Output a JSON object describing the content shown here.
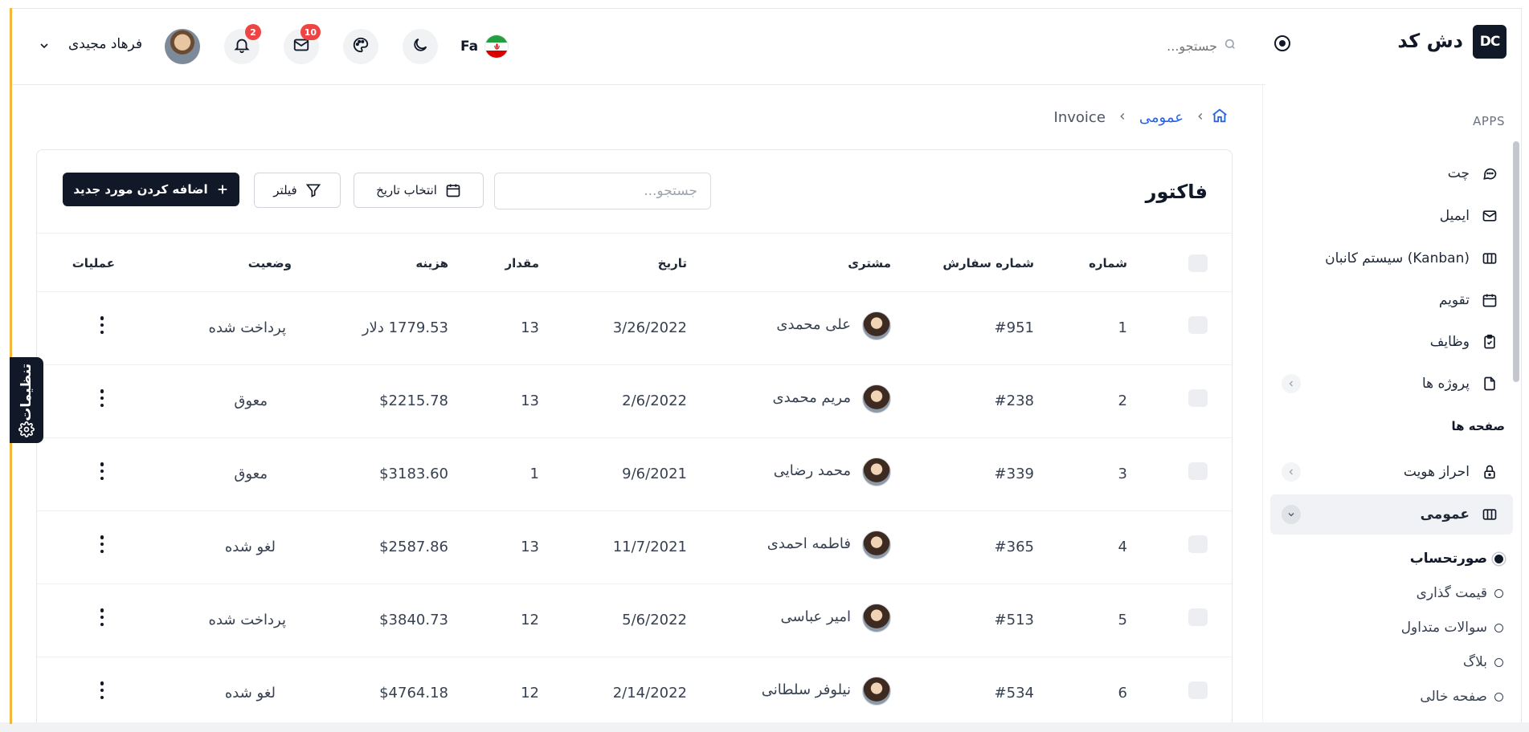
{
  "app": {
    "brand": "دش کد",
    "logo_text": "DC"
  },
  "sidebar": {
    "section_apps": "APPS",
    "apps": [
      {
        "label": "چت",
        "icon": "chat-icon"
      },
      {
        "label": "ایمیل",
        "icon": "mail-icon"
      },
      {
        "label": "سیستم کانبان (Kanban)",
        "icon": "kanban-icon"
      },
      {
        "label": "تقویم",
        "icon": "calendar-icon"
      },
      {
        "label": "وظایف",
        "icon": "clipboard-icon"
      },
      {
        "label": "پروژه ها",
        "icon": "file-icon"
      }
    ],
    "section_pages": "صفحه ها",
    "pages": [
      {
        "label": "احراز هویت",
        "icon": "lock-icon"
      },
      {
        "label": "عمومی",
        "icon": "columns-icon"
      }
    ],
    "sub_items": [
      {
        "label": "صورتحساب",
        "active": true
      },
      {
        "label": "قیمت گذاری",
        "active": false
      },
      {
        "label": "سوالات متداول",
        "active": false
      },
      {
        "label": "بلاگ",
        "active": false
      },
      {
        "label": "صفحه خالی",
        "active": false
      }
    ]
  },
  "header": {
    "search_placeholder": "جستجو...",
    "language": "Fa",
    "mail_count": "10",
    "notification_count": "2",
    "user_name": "فرهاد مجیدی"
  },
  "breadcrumb": {
    "parent": "عمومی",
    "current": "Invoice"
  },
  "card": {
    "title": "فاکتور",
    "search_placeholder": "جستجو...",
    "date_button": "انتخاب تاریخ",
    "filter_button": "فیلتر",
    "add_button": "اضافه کردن مورد جدید"
  },
  "table": {
    "columns": {
      "number": "شماره",
      "order": "شماره سفارش",
      "customer": "مشتری",
      "date": "تاریخ",
      "quantity": "مقدار",
      "cost": "هزینه",
      "status": "وضعیت",
      "actions": "عملیات"
    },
    "rows": [
      {
        "number": "1",
        "order": "#951",
        "customer": "علی محمدی",
        "date": "3/26/2022",
        "quantity": "13",
        "cost": "1779.53 دلار",
        "status": "پرداخت شده"
      },
      {
        "number": "2",
        "order": "#238",
        "customer": "مریم محمدی",
        "date": "2/6/2022",
        "quantity": "13",
        "cost": "$2215.78",
        "status": "معوق"
      },
      {
        "number": "3",
        "order": "#339",
        "customer": "محمد رضایی",
        "date": "9/6/2021",
        "quantity": "1",
        "cost": "$3183.60",
        "status": "معوق"
      },
      {
        "number": "4",
        "order": "#365",
        "customer": "فاطمه احمدی",
        "date": "11/7/2021",
        "quantity": "13",
        "cost": "$2587.86",
        "status": "لغو شده"
      },
      {
        "number": "5",
        "order": "#513",
        "customer": "امیر عباسی",
        "date": "5/6/2022",
        "quantity": "12",
        "cost": "$3840.73",
        "status": "پرداخت شده"
      },
      {
        "number": "6",
        "order": "#534",
        "customer": "نیلوفر سلطانی",
        "date": "2/14/2022",
        "quantity": "12",
        "cost": "$4764.18",
        "status": "لغو شده"
      }
    ]
  },
  "settings_tab": {
    "label": "تنظیمات"
  }
}
